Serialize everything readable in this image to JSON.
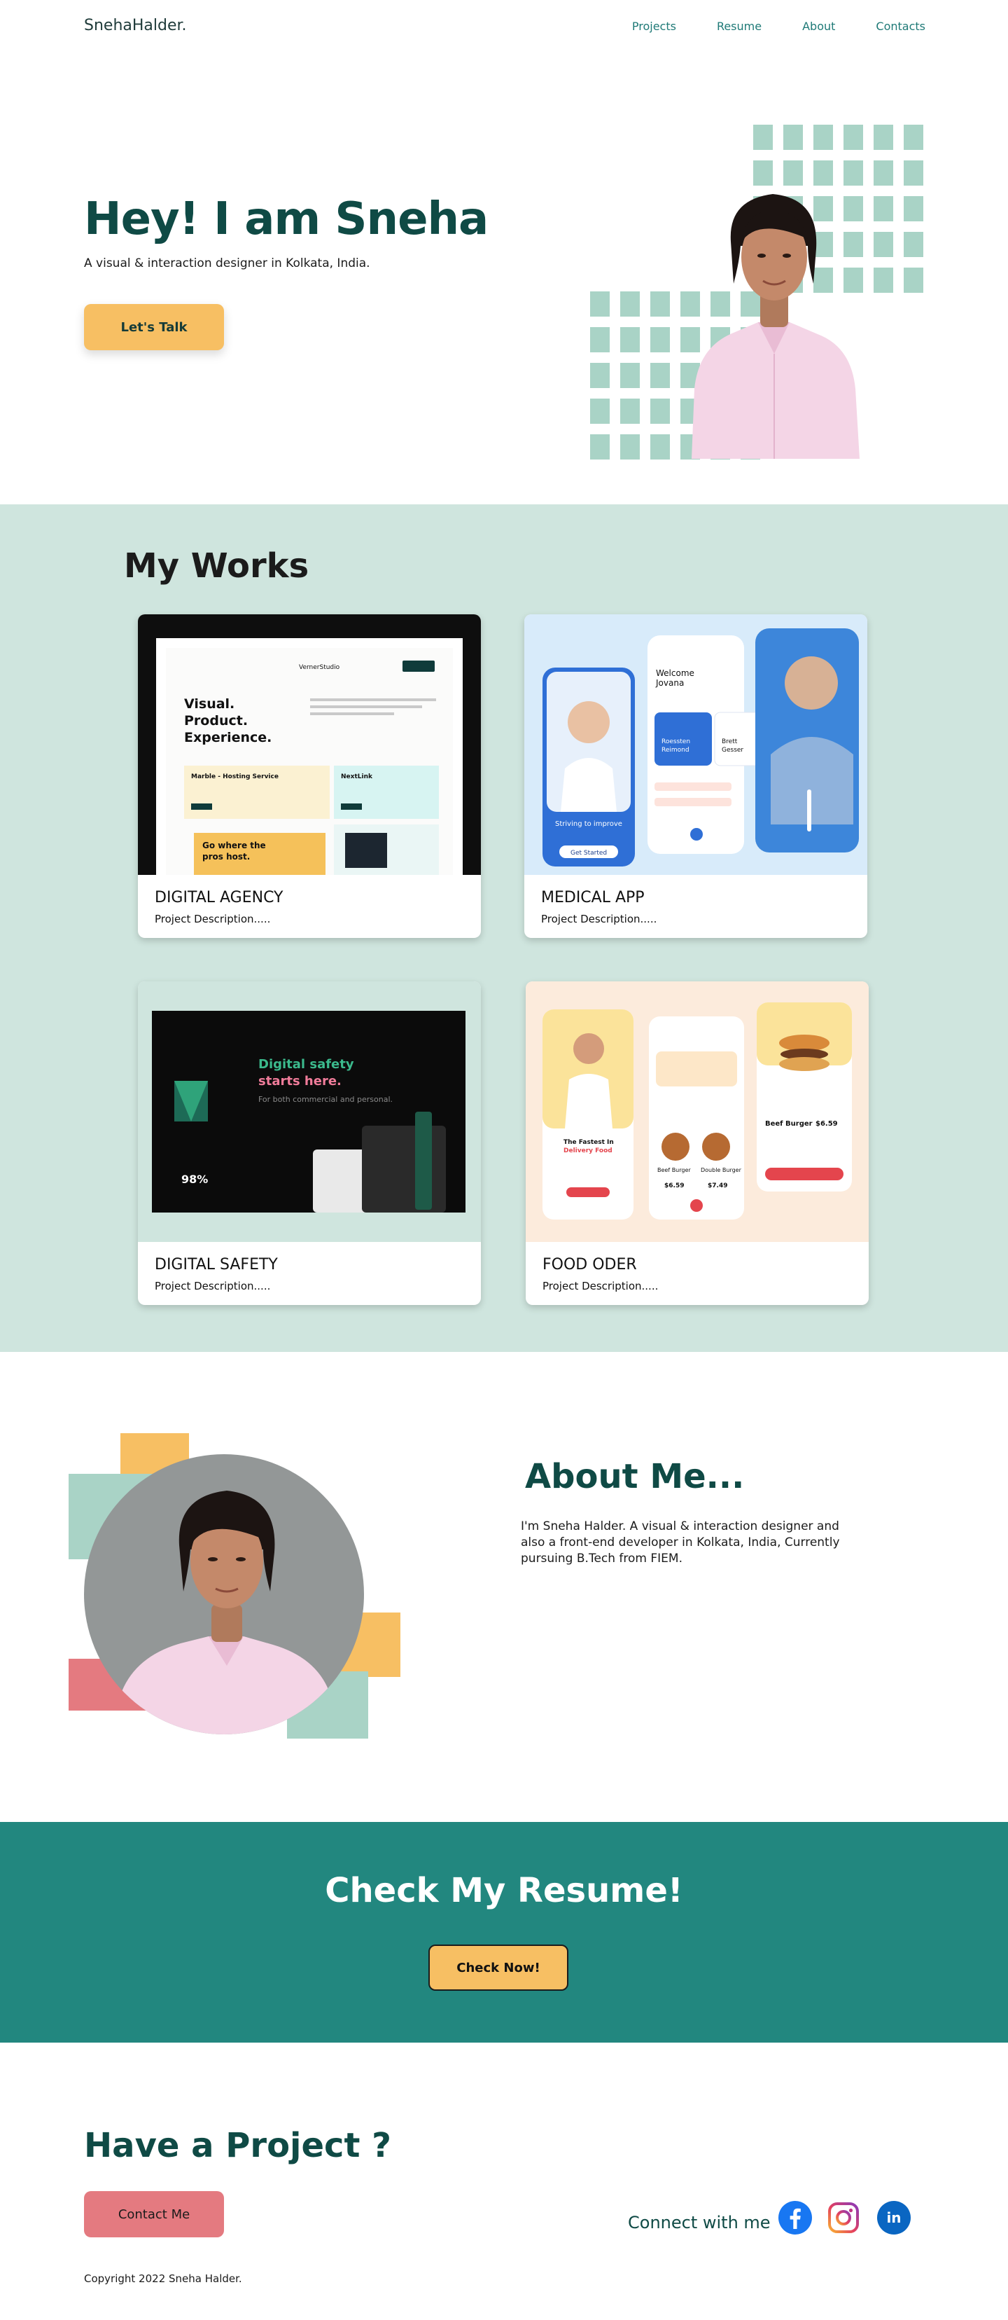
{
  "nav": {
    "logo": "SnehaHalder.",
    "links": [
      "Projects",
      "Resume",
      "About",
      "Contacts"
    ]
  },
  "hero": {
    "title": "Hey! I am Sneha",
    "subtitle": "A visual & interaction designer in Kolkata, India.",
    "cta_label": "Let's Talk"
  },
  "works": {
    "title": "My Works",
    "projects": [
      {
        "title": "DIGITAL AGENCY",
        "description": "Project Description.....",
        "preview": {
          "brand": "VernerStudio",
          "headline": [
            "Visual.",
            "Product.",
            "Experience."
          ],
          "card_a": "Marble - Hosting Service",
          "card_b": "NextLink",
          "banner": [
            "Go where the",
            "pros host."
          ]
        }
      },
      {
        "title": "MEDICAL APP",
        "description": "Project Description.....",
        "preview": {
          "welcome": [
            "Welcome",
            "Jovana"
          ],
          "doctor_a": [
            "Roessten",
            "Reimond"
          ],
          "doctor_b": [
            "Brett",
            "Gesser"
          ],
          "strapline": "Striving to improve",
          "cta": "Get Started"
        }
      },
      {
        "title": "DIGITAL SAFETY",
        "description": "Project Description.....",
        "preview": {
          "headline_a": "Digital safety",
          "headline_b": "starts here.",
          "headline_c": "For both commercial and personal.",
          "stat": "98%"
        }
      },
      {
        "title": "FOOD ODER",
        "description": "Project Description.....",
        "preview": {
          "promo": [
            "The Fastest In",
            "Delivery Food"
          ],
          "item_a": "Beef Burger",
          "item_b": "Double Burger",
          "price_a": "$6.59",
          "price_b": "$7.49",
          "detail_title": "Beef Burger",
          "detail_price": "$6.59"
        }
      }
    ]
  },
  "about": {
    "title": "About Me...",
    "text": "I'm Sneha Halder. A visual & interaction designer and also a front-end developer in Kolkata, India, Currently pursuing B.Tech from FIEM."
  },
  "resume": {
    "title": "Check My Resume!",
    "button_label": "Check Now!"
  },
  "footer": {
    "title": "Have a Project ?",
    "contact_label": "Contact Me",
    "connect_label": "Connect with me",
    "copyright": "Copyright 2022 Sneha Halder.",
    "social": [
      "facebook-icon",
      "instagram-icon",
      "linkedin-icon"
    ],
    "linkedin_glyph": "in"
  },
  "colors": {
    "accent_dark": "#0f4a45",
    "teal": "#22877f",
    "mint": "#cfe5de",
    "yellow": "#f7bf63",
    "pink": "#e47a80"
  }
}
